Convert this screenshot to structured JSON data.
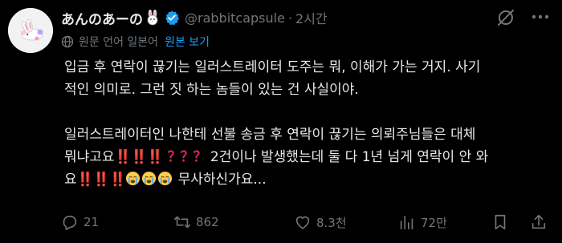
{
  "user": {
    "display_name": "あんのあーの",
    "handle": "@rabbitcapsule",
    "time": "2시간"
  },
  "translation": {
    "note": "원문 언어 일본어",
    "show_original": "원본 보기"
  },
  "post": {
    "para1_line1": "입금 후 연락이 끊기는 일러스트레이터 도주는 뭐, 이해가 가는 거지. 사기",
    "para1_line2": "적인 의미로. 그런 짓 하는 놈들이 있는 건 사실이야.",
    "para2_line1": "일러스트레이터인 나한테 선불 송금 후 연락이 끊기는 의뢰주님들은 대체",
    "para2_line2_text": "뭐냐고요",
    "para2_line2_marks": "‼️‼️‼️",
    "para2_line2_questions": "？？？",
    "para2_line2_rest": "2건이나 발생했는데 둘 다 1년 넘게 연락이 안 와",
    "para2_line3_text": "요",
    "para2_line3_marks": "‼️‼️‼️",
    "para2_line3_rest": "무사하신가요..."
  },
  "actions": {
    "replies": "21",
    "reposts": "862",
    "likes": "8.3천",
    "views": "72만"
  },
  "icons": {
    "avatar": "rabbit-avatar",
    "verified": "verified-badge-icon",
    "grok": "grok-icon",
    "more": "more-icon",
    "reply": "reply-icon",
    "repost": "repost-icon",
    "like": "heart-icon",
    "views": "views-icon"
  },
  "colors": {
    "background": "#000000",
    "text": "#e7e9ea",
    "muted": "#71767b",
    "accent": "#1d9bf0",
    "emphasis": "#e0245e"
  }
}
